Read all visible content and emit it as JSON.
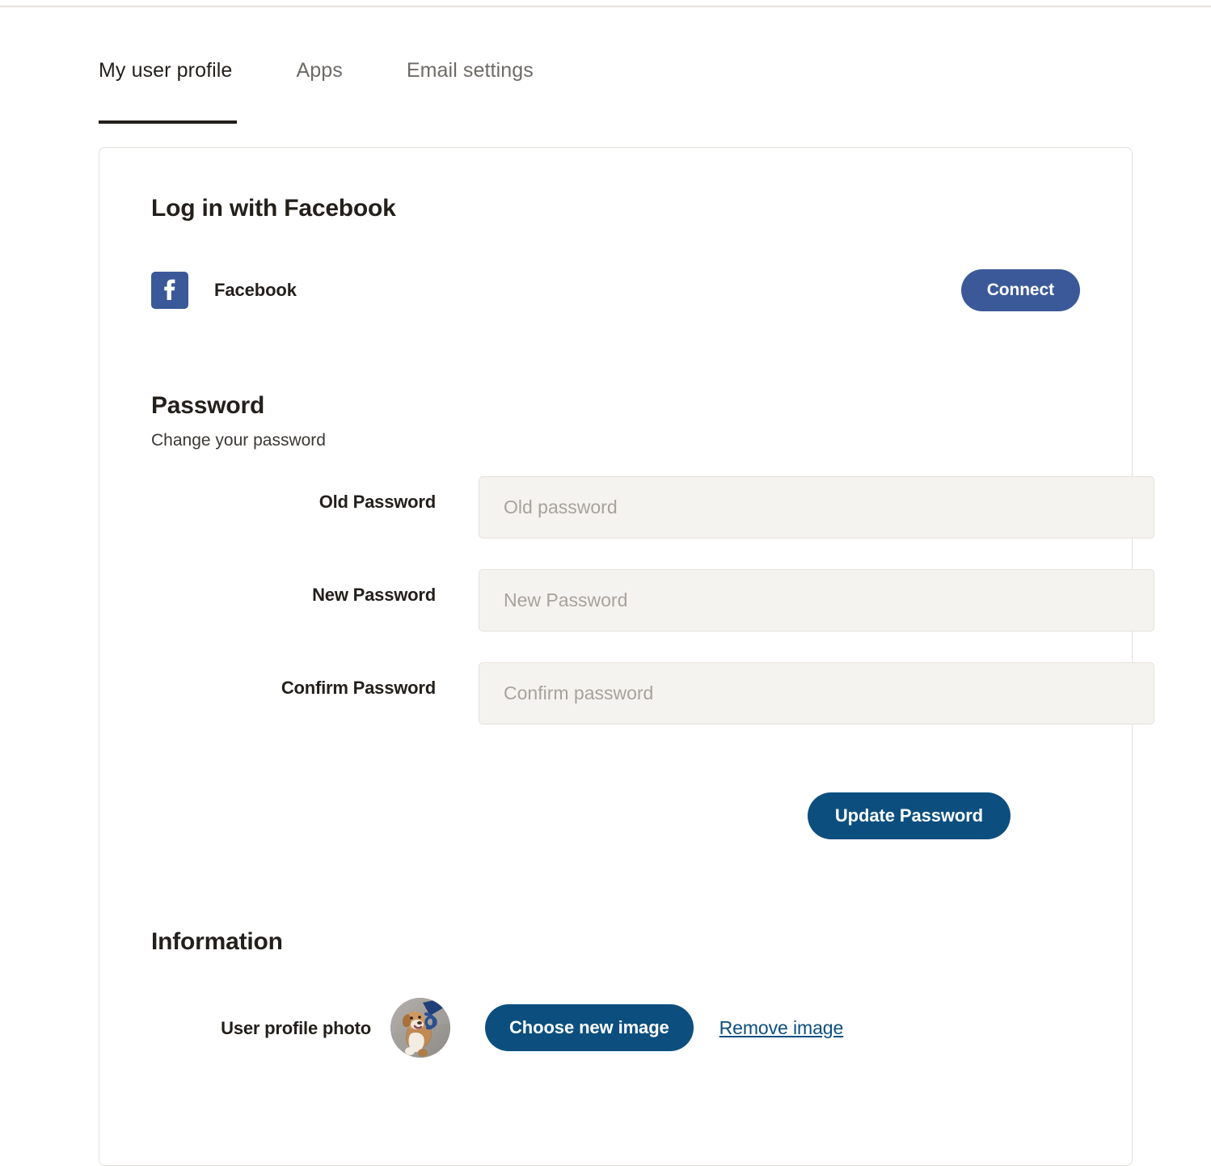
{
  "tabs": [
    {
      "label": "My user profile",
      "active": true
    },
    {
      "label": "Apps",
      "active": false
    },
    {
      "label": "Email settings",
      "active": false
    }
  ],
  "facebook_section": {
    "heading": "Log in with Facebook",
    "provider_name": "Facebook",
    "provider_icon": "facebook-icon",
    "connect_label": "Connect",
    "connect_color": "#3b5998"
  },
  "password_section": {
    "heading": "Password",
    "subheading": "Change your password",
    "fields": [
      {
        "label": "Old Password",
        "placeholder": "Old password",
        "value": ""
      },
      {
        "label": "New Password",
        "placeholder": "New Password",
        "value": ""
      },
      {
        "label": "Confirm Password",
        "placeholder": "Confirm password",
        "value": ""
      }
    ],
    "submit_label": "Update Password",
    "submit_color": "#0c4f7f"
  },
  "information_section": {
    "heading": "Information",
    "photo_label": "User profile photo",
    "avatar_icon": "user-avatar-dog-photo",
    "choose_label": "Choose new image",
    "remove_label": "Remove image",
    "link_color": "#0c4f7f"
  }
}
